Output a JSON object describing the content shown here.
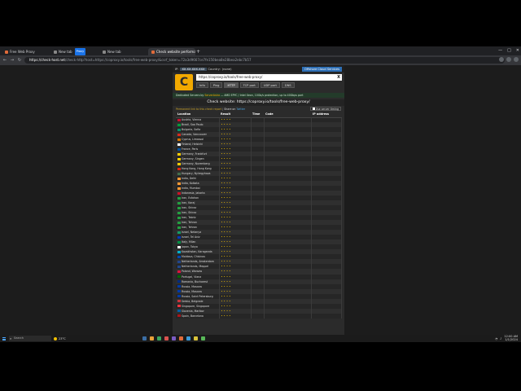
{
  "browser": {
    "tabs": [
      {
        "label": "Free Web Proxy",
        "active": false
      },
      {
        "label": "New tab",
        "active": false,
        "badge": "Proxy"
      },
      {
        "label": "New tab",
        "active": false
      },
      {
        "label": "Check website performance and…",
        "active": true
      }
    ],
    "url_host": "https://check-host.net",
    "url_rest": "/check-http?host=https://coproxy.io/tools/free-web-proxy/&csrf_token=72a3d9667ce7fe150bea8e28bea2ebc7b57"
  },
  "site": {
    "ip_label": "IP:",
    "ip_value": "XX.XX.XXX.XXX",
    "country_label": "Country:",
    "country_value": "(none)",
    "offshore_button": "Offshore Cloud Services",
    "logo_letter": "C",
    "input_value": "https://coproxy.io/tools/free-web-proxy/",
    "clear_label": "X",
    "check_types": [
      "Info",
      "Ping",
      "HTTP",
      "TCP port",
      "UDP port",
      "DNS"
    ],
    "selected_type": "HTTP",
    "promo_prefix": "Dedicated Servers by ",
    "promo_brand": "ServerAstra",
    "promo_rest": " — AMD EPYC / Intel Xeon, 10Gb/s protection, up to 40Gbps port",
    "page_title": "Check website: https://coproxy.io/tools/free-web-proxy/",
    "permanent_link": "Permanent link to this check report",
    "share_label": "Share on",
    "share_target": "Twitter",
    "server_timing_label": "Use server timing",
    "columns": [
      "Location",
      "Result",
      "Time",
      "Code",
      "IP address"
    ]
  },
  "results": [
    {
      "flag": "#c8102e",
      "location": "Austria, Vienna",
      "result": "• • • •"
    },
    {
      "flag": "#009c3b",
      "location": "Brazil, Sao Paulo",
      "result": "• • • •"
    },
    {
      "flag": "#00966e",
      "location": "Bulgaria, Sofia",
      "result": "• • • •"
    },
    {
      "flag": "#d52b1e",
      "location": "Canada, Vancouver",
      "result": "• • • •"
    },
    {
      "flag": "#d47600",
      "location": "Cyprus, Limassol",
      "result": "• • • •"
    },
    {
      "flag": "#ffffff",
      "location": "Finland, Helsinki",
      "result": "• • • •"
    },
    {
      "flag": "#0055a4",
      "location": "France, Paris",
      "result": "• • • •"
    },
    {
      "flag": "#ffce00",
      "location": "Germany, Frankfurt",
      "result": "• • • •"
    },
    {
      "flag": "#ffce00",
      "location": "Germany, Singen",
      "result": "• • • •"
    },
    {
      "flag": "#ffce00",
      "location": "Germany, Nuremberg",
      "result": "• • • •"
    },
    {
      "flag": "#de2910",
      "location": "Hong Kong, Hong Kong",
      "result": "• • • •"
    },
    {
      "flag": "#436f4d",
      "location": "Hungary, Nyiregyhaza",
      "result": "• • • •"
    },
    {
      "flag": "#ff9933",
      "location": "India, Delhi",
      "result": "• • • •"
    },
    {
      "flag": "#ff9933",
      "location": "India, Kolkata",
      "result": "• • • •"
    },
    {
      "flag": "#ff9933",
      "location": "India, Mumbai",
      "result": "• • • •"
    },
    {
      "flag": "#ce1126",
      "location": "Indonesia, Jakarta",
      "result": "• • • •"
    },
    {
      "flag": "#239f40",
      "location": "Iran, Esfahan",
      "result": "• • • •"
    },
    {
      "flag": "#239f40",
      "location": "Iran, Karaj",
      "result": "• • • •"
    },
    {
      "flag": "#239f40",
      "location": "Iran, Shiraz",
      "result": "• • • •"
    },
    {
      "flag": "#239f40",
      "location": "Iran, Shiraz",
      "result": "• • • •"
    },
    {
      "flag": "#239f40",
      "location": "Iran, Tabriz",
      "result": "• • • •"
    },
    {
      "flag": "#239f40",
      "location": "Iran, Tehran",
      "result": "• • • •"
    },
    {
      "flag": "#239f40",
      "location": "Iran, Tehran",
      "result": "• • • •"
    },
    {
      "flag": "#169b62",
      "location": "Israel, Netanya",
      "result": "• • • •"
    },
    {
      "flag": "#0038b8",
      "location": "Israel, Tel Aviv",
      "result": "• • • •"
    },
    {
      "flag": "#009246",
      "location": "Italy, Milan",
      "result": "• • • •"
    },
    {
      "flag": "#ffffff",
      "location": "Japan, Tokyo",
      "result": "• • • •"
    },
    {
      "flag": "#00afca",
      "location": "Kazakhstan, Karaganda",
      "result": "• • • •"
    },
    {
      "flag": "#0046ae",
      "location": "Moldova, Chisinau",
      "result": "• • • •"
    },
    {
      "flag": "#21468b",
      "location": "Netherlands, Amsterdam",
      "result": "• • • •"
    },
    {
      "flag": "#21468b",
      "location": "Netherlands, Meppel",
      "result": "• • • •"
    },
    {
      "flag": "#dc143c",
      "location": "Poland, Warsaw",
      "result": "• • • •"
    },
    {
      "flag": "#006600",
      "location": "Portugal, Viana",
      "result": "• • • •"
    },
    {
      "flag": "#002b7f",
      "location": "Romania, Bucharest",
      "result": "• • • •"
    },
    {
      "flag": "#0039a6",
      "location": "Russia, Moscow",
      "result": "• • • •"
    },
    {
      "flag": "#0039a6",
      "location": "Russia, Moscow",
      "result": "• • • •"
    },
    {
      "flag": "#0039a6",
      "location": "Russia, Saint Petersburg",
      "result": "• • • •"
    },
    {
      "flag": "#c6363c",
      "location": "Serbia, Belgrade",
      "result": "• • • •"
    },
    {
      "flag": "#ef3340",
      "location": "Singapore, Singapore",
      "result": "• • • •"
    },
    {
      "flag": "#005da4",
      "location": "Slovenia, Maribor",
      "result": "• • • •"
    },
    {
      "flag": "#aa151b",
      "location": "Spain, Barcelona",
      "result": "• • • •"
    }
  ],
  "taskbar": {
    "search_placeholder": "Search",
    "weather_text": "23°C",
    "app_colors": [
      "#3b6ea5",
      "#e8a13a",
      "#3aa55d",
      "#d9534f",
      "#7a5cc2",
      "#e06b3a",
      "#3a9ad9",
      "#d9c33a",
      "#58b858"
    ],
    "time": "12:00 AM",
    "date": "1/1/2024"
  }
}
